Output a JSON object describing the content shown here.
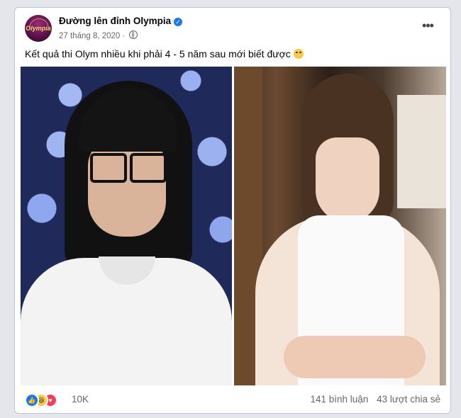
{
  "post": {
    "page_name": "Đường lên đỉnh Olympia",
    "avatar_text": "Olympia",
    "date": "27 tháng 8, 2020",
    "date_separator": "·",
    "more_label": "•••",
    "text": "Kết quả thi Olym nhiều khi phải 4 - 5 năm sau mới biết được"
  },
  "reactions": {
    "count": "10K",
    "icons": [
      "like-icon",
      "haha-icon",
      "love-icon"
    ]
  },
  "stats": {
    "comments": "141 bình luận",
    "shares": "43 lượt chia sẻ"
  },
  "colors": {
    "accent": "#1877f2",
    "love": "#f33e58",
    "haha": "#f7c948"
  }
}
